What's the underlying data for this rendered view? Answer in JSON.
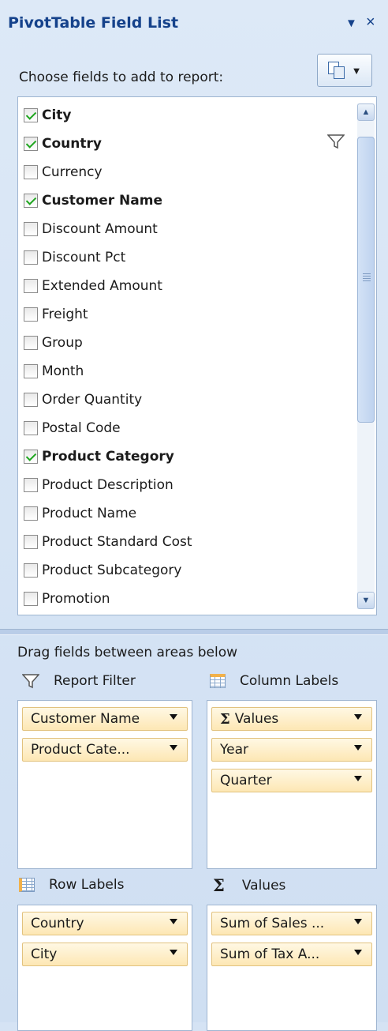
{
  "title": "PivotTable Field List",
  "title_controls": {
    "dropdown_icon": "triangle-down",
    "close_symbol": "×"
  },
  "choose_label": "Choose fields to add to report:",
  "fields": [
    {
      "label": "City",
      "checked": true
    },
    {
      "label": "Country",
      "checked": true,
      "filtered": true
    },
    {
      "label": "Currency",
      "checked": false
    },
    {
      "label": "Customer Name",
      "checked": true
    },
    {
      "label": "Discount Amount",
      "checked": false
    },
    {
      "label": "Discount Pct",
      "checked": false
    },
    {
      "label": "Extended Amount",
      "checked": false
    },
    {
      "label": "Freight",
      "checked": false
    },
    {
      "label": "Group",
      "checked": false
    },
    {
      "label": "Month",
      "checked": false
    },
    {
      "label": "Order Quantity",
      "checked": false
    },
    {
      "label": "Postal Code",
      "checked": false
    },
    {
      "label": "Product Category",
      "checked": true
    },
    {
      "label": "Product Description",
      "checked": false
    },
    {
      "label": "Product Name",
      "checked": false
    },
    {
      "label": "Product Standard Cost",
      "checked": false
    },
    {
      "label": "Product Subcategory",
      "checked": false
    },
    {
      "label": "Promotion",
      "checked": false
    }
  ],
  "drag_label": "Drag fields between areas below",
  "areas": {
    "report_filter": {
      "label": "Report Filter",
      "items": [
        "Customer Name",
        "Product Cate..."
      ]
    },
    "column_labels": {
      "label": "Column Labels",
      "items": [
        "Values",
        "Year",
        "Quarter"
      ]
    },
    "row_labels": {
      "label": "Row Labels",
      "items": [
        "Country",
        "City"
      ]
    },
    "values": {
      "label": "Values",
      "items": [
        "Sum of Sales ...",
        "Sum of Tax A..."
      ]
    }
  },
  "sigma_symbol": "Σ",
  "colors": {
    "title": "#15428b",
    "pane": "#d5e3f4",
    "chip": "#fde7b4",
    "check": "#1fa61f"
  }
}
